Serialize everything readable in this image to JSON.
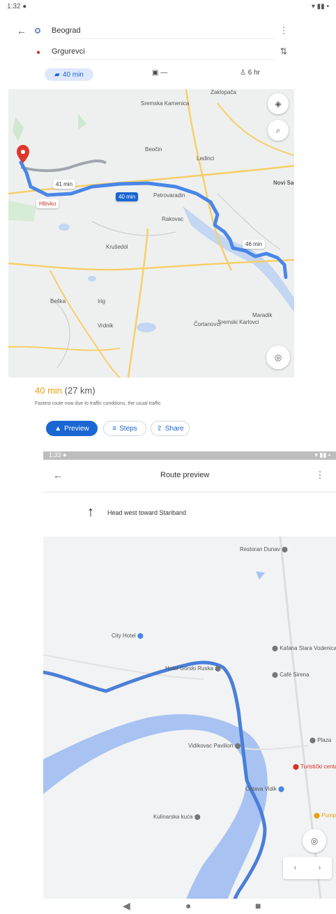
{
  "status_top": {
    "time": "1:32 ●",
    "icons": "▾ ▮▮ ▪"
  },
  "search": {
    "destination": "Beograd",
    "origin": "Grgurevci"
  },
  "modes": [
    {
      "icon": "car-icon",
      "label": "40 min"
    },
    {
      "icon": "transit-icon",
      "label": "—"
    },
    {
      "icon": "walk-icon",
      "label": "6 hr"
    }
  ],
  "map1": {
    "labels": [
      "Zaklopača",
      "Beočin",
      "Ledinci",
      "Rakovac",
      "Sremski Karlovci",
      "Irig",
      "Krušedol",
      "Vrdnik",
      "Novi Sad",
      "Petrovaradin",
      "Sremska Kamenica",
      "Čortanovci",
      "Beška",
      "Maradik"
    ],
    "route_tags": {
      "alt1": "41 min",
      "main": "40 min",
      "alt2": "46 min",
      "poi": "Hlbvko"
    }
  },
  "summary": {
    "time": "40 min",
    "distance": "(27 km)",
    "note": "Fastest route now due to traffic conditions, the usual traffic"
  },
  "actions": {
    "preview": "Preview",
    "steps": "Steps",
    "share": "Share"
  },
  "status_bottom": {
    "time": "1:33 ●",
    "icons": "▾ ▮▮ ▪"
  },
  "preview_header": {
    "title": "Route preview"
  },
  "instruction": {
    "text": "Head west toward Stariband"
  },
  "map2": {
    "pois": [
      "Restoran Dunav",
      "City Hotel",
      "Hotel Gorski Ruska",
      "Kafana Stara Vodenica",
      "Café Sirena",
      "Plaza",
      "Vidikovac Pavilion",
      "Turistički centar",
      "Ostava Vidik",
      "Kulinarska kuća",
      "Pumpa"
    ]
  }
}
